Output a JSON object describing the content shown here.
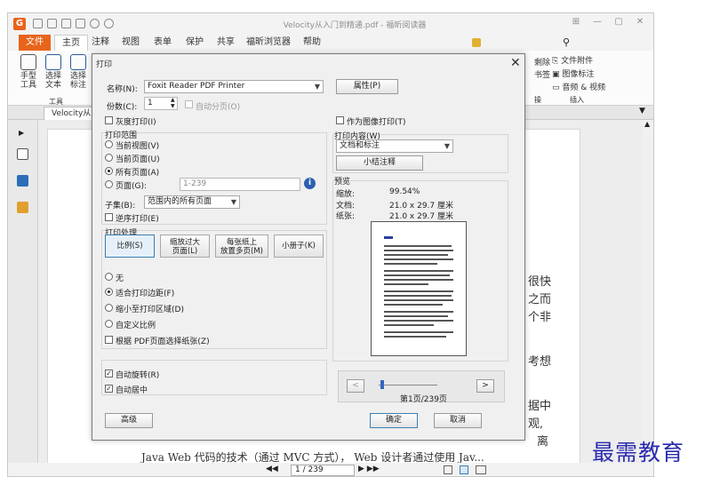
{
  "app": {
    "title": "Velocity从入门到精通.pdf - 福昕阅读器",
    "logo": "G",
    "menu": [
      "文件",
      "主页",
      "注释",
      "视图",
      "表单",
      "保护",
      "共享",
      "福昕浏览器",
      "帮助"
    ],
    "search_placeholder": "查找",
    "ribbon": {
      "hand": "手型\n工具",
      "select_text": "选择\n文本",
      "select_annot": "选择\n标注",
      "group_tools": "工具",
      "file_attach": "文件附件",
      "image_annot": "图像标注",
      "audio_video": "音频 & 视频",
      "group_insert": "插入",
      "cut1": "剩除",
      "cut2": "书签",
      "cut3": "操"
    },
    "doc_tab": "Velocity从入门...",
    "page_field": "1 / 239",
    "doc_text": {
      "r1": "很快",
      "r2": "之而",
      "r3": "个非",
      "r4": "考想",
      "r5": "据中",
      "r6": "观,",
      "r7": "离",
      "bottom": "Java Web 代码的技术（通过 MVC 方式）， Web 设计者通过使用 Jav..."
    },
    "watermark": "最需教育"
  },
  "dialog": {
    "title": "打印",
    "name_label": "名称(N):",
    "printer": "Foxit Reader PDF Printer",
    "properties_button": "属性(P)",
    "copies_label": "份数(C):",
    "copies_value": "1",
    "collate_label": "自动分页(O)",
    "grayscale_label": "灰度打印(I)",
    "print_as_image_label": "作为图像打印(T)",
    "range_group": "打印范围",
    "range_current_view": "当前视图(V)",
    "range_current_page": "当前页面(U)",
    "range_all_pages": "所有页面(A)",
    "range_pages": "页面(G):",
    "range_pages_value": "1-239",
    "subset_label": "子集(B):",
    "subset_value": "范围内的所有页面",
    "reverse_label": "逆序打印(E)",
    "handling_group": "打印处理",
    "scale_buttons": [
      "比例(S)",
      "缩放过大\n页面(L)",
      "每张纸上\n放置多页(M)",
      "小册子(K)"
    ],
    "scale_none": "无",
    "scale_fit": "适合打印边距(F)",
    "scale_shrink": "缩小至打印区域(D)",
    "scale_custom": "自定义比例",
    "paper_by_pdf": "根据 PDF页面选择纸张(Z)",
    "auto_rotate": "自动旋转(R)",
    "auto_center": "自动居中",
    "advanced_button": "高级",
    "content_group": "打印内容(W)",
    "content_value": "文档和标注",
    "summarize_button": "小结注释",
    "preview_group": "预览",
    "zoom_label": "缩放:",
    "zoom_value": "99.54%",
    "doc_label": "文档:",
    "doc_size": "21.0 x 29.7 厘米",
    "paper_label": "纸张:",
    "paper_size": "21.0 x 29.7 厘米",
    "page_indicator": "第1页/239页",
    "prev": "<",
    "next": ">",
    "ok_button": "确定",
    "cancel_button": "取消"
  },
  "colors": {
    "brand": "#e8641b",
    "accent": "#3c7fb1",
    "watermark": "#2a2ab0"
  }
}
